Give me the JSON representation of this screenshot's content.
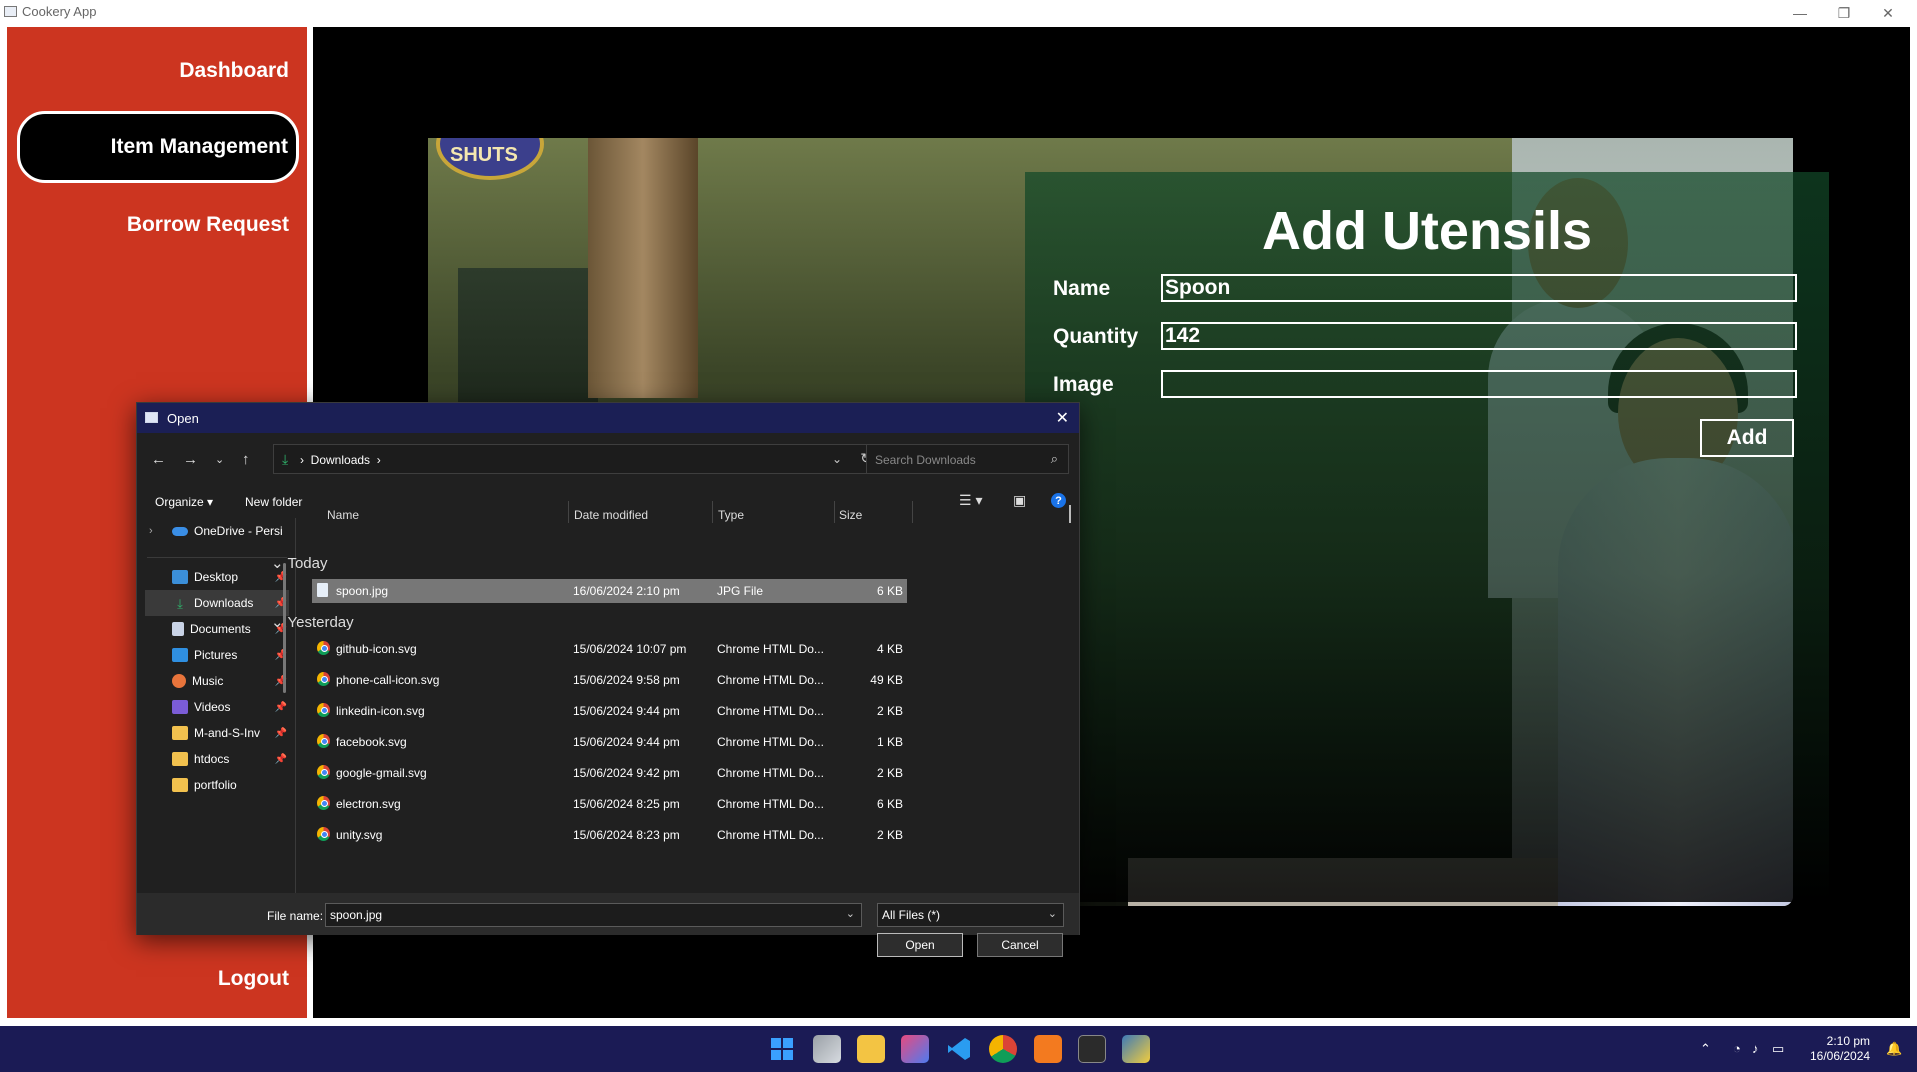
{
  "window": {
    "title": "Cookery App",
    "minimize": "—",
    "restore": "❐",
    "close": "✕"
  },
  "sidebar": {
    "items": [
      {
        "label": "Dashboard"
      },
      {
        "label": "Item Management"
      },
      {
        "label": "Borrow Request"
      }
    ],
    "logout": "Logout"
  },
  "colors": {
    "sidebar": "#cc3520",
    "content_bg": "#000000",
    "overlay": "#124828",
    "taskbar": "#1b1b55"
  },
  "form": {
    "title": "Add Utensils",
    "fields": [
      {
        "label": "Name",
        "value": "Spoon"
      },
      {
        "label": "Quantity",
        "value": "142"
      },
      {
        "label": "Image",
        "value": ""
      }
    ],
    "add_button": "Add",
    "badge_text": "SHUTS"
  },
  "dialog": {
    "title": "Open",
    "breadcrumb": [
      "Downloads"
    ],
    "search_placeholder": "Search Downloads",
    "toolbar": {
      "organize": "Organize",
      "new_folder": "New folder"
    },
    "nav_items": [
      {
        "label": "OneDrive - Persi",
        "icon": "onedrive-icon"
      },
      {
        "label": "Desktop",
        "icon": "desktop-icon"
      },
      {
        "label": "Downloads",
        "icon": "downloads-icon"
      },
      {
        "label": "Documents",
        "icon": "documents-icon"
      },
      {
        "label": "Pictures",
        "icon": "pictures-icon"
      },
      {
        "label": "Music",
        "icon": "music-icon"
      },
      {
        "label": "Videos",
        "icon": "videos-icon"
      },
      {
        "label": "M-and-S-Inv",
        "icon": "folder-icon"
      },
      {
        "label": "htdocs",
        "icon": "folder-icon"
      },
      {
        "label": "portfolio",
        "icon": "folder-icon"
      }
    ],
    "columns": [
      "Name",
      "Date modified",
      "Type",
      "Size"
    ],
    "groups": [
      {
        "label": "Today",
        "files": [
          {
            "name": "spoon.jpg",
            "date": "16/06/2024 2:10 pm",
            "type": "JPG File",
            "size": "6 KB"
          }
        ]
      },
      {
        "label": "Yesterday",
        "files": [
          {
            "name": "github-icon.svg",
            "date": "15/06/2024 10:07 pm",
            "type": "Chrome HTML Do...",
            "size": "4 KB"
          },
          {
            "name": "phone-call-icon.svg",
            "date": "15/06/2024 9:58 pm",
            "type": "Chrome HTML Do...",
            "size": "49 KB"
          },
          {
            "name": "linkedin-icon.svg",
            "date": "15/06/2024 9:44 pm",
            "type": "Chrome HTML Do...",
            "size": "2 KB"
          },
          {
            "name": "facebook.svg",
            "date": "15/06/2024 9:44 pm",
            "type": "Chrome HTML Do...",
            "size": "1 KB"
          },
          {
            "name": "google-gmail.svg",
            "date": "15/06/2024 9:42 pm",
            "type": "Chrome HTML Do...",
            "size": "2 KB"
          },
          {
            "name": "electron.svg",
            "date": "15/06/2024 8:25 pm",
            "type": "Chrome HTML Do...",
            "size": "6 KB"
          },
          {
            "name": "unity.svg",
            "date": "15/06/2024 8:23 pm",
            "type": "Chrome HTML Do...",
            "size": "2 KB"
          }
        ]
      }
    ],
    "file_name_label": "File name:",
    "file_name_value": "spoon.jpg",
    "file_type": "All Files (*)",
    "open_button": "Open",
    "cancel_button": "Cancel"
  },
  "taskbar": {
    "apps": [
      "start-icon",
      "task-view-icon",
      "file-explorer-icon",
      "app-icon",
      "vscode-icon",
      "chrome-icon",
      "xampp-icon",
      "terminal-icon",
      "python-icon"
    ],
    "time": "2:10 pm",
    "date": "16/06/2024"
  }
}
